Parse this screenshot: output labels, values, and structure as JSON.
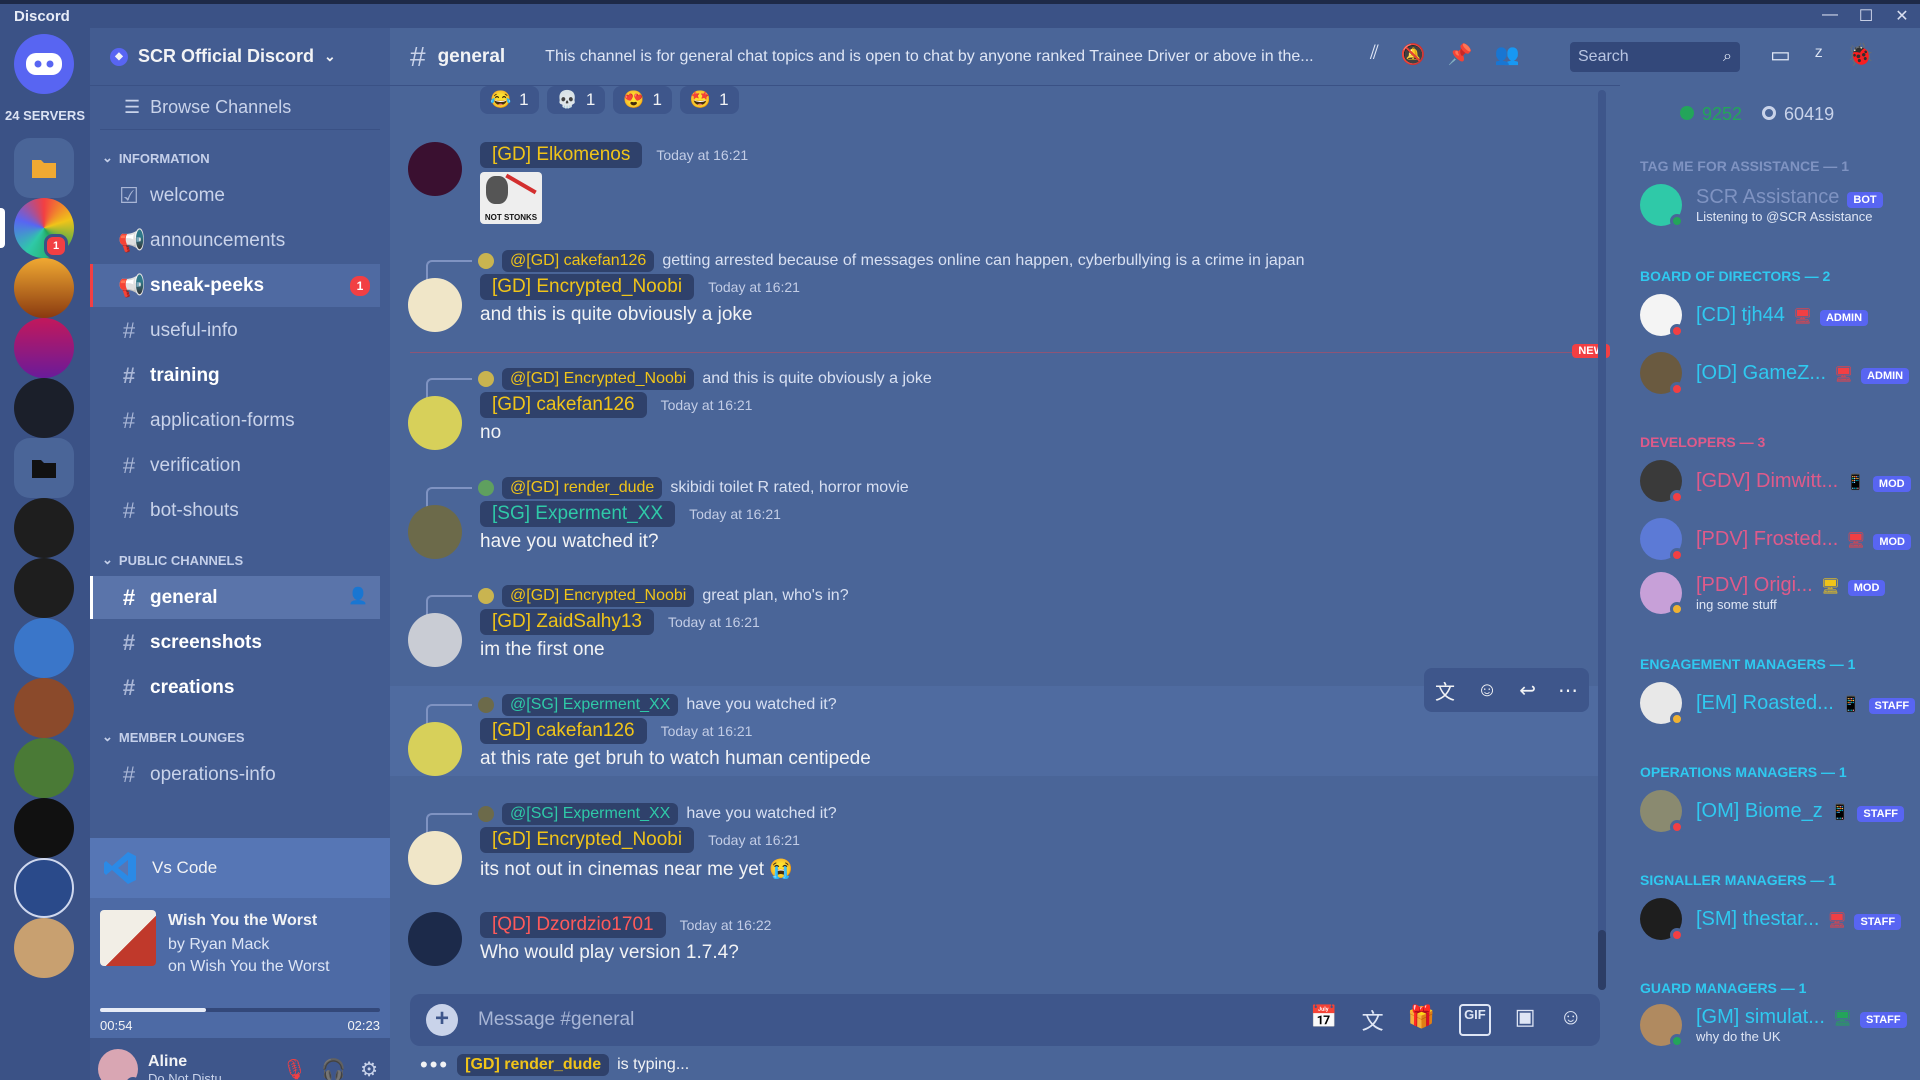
{
  "app": {
    "title": "Discord",
    "min": "—",
    "max": "☐",
    "close": "✕"
  },
  "rail": {
    "servers_count": "24 SERVERS",
    "badge": "1"
  },
  "guild": {
    "name": "SCR Official Discord",
    "browse": "Browse Channels",
    "categories": {
      "information": "INFORMATION",
      "public": "PUBLIC CHANNELS",
      "lounges": "MEMBER LOUNGES"
    },
    "channels": {
      "welcome": "welcome",
      "announcements": "announcements",
      "sneak_peeks": "sneak-peeks",
      "sneak_peeks_count": "1",
      "useful_info": "useful-info",
      "training": "training",
      "application_forms": "application-forms",
      "verification": "verification",
      "bot_shouts": "bot-shouts",
      "general": "general",
      "screenshots": "screenshots",
      "creations": "creations",
      "operations_info": "operations-info"
    }
  },
  "activity": {
    "app": "Vs Code"
  },
  "music": {
    "title": "Wish You the Worst",
    "artist": "by Ryan Mack",
    "album": "on Wish You the Worst",
    "elapsed": "00:54",
    "total": "02:23",
    "progress": 0.38
  },
  "user": {
    "name": "Aline",
    "status": "Do Not Distu..."
  },
  "header": {
    "channel": "general",
    "topic": "This channel is for general chat topics and is open to chat by anyone ranked Trainee Driver or above in the...",
    "search_placeholder": "Search"
  },
  "reactions": [
    {
      "emoji": "😂",
      "count": "1"
    },
    {
      "emoji": "💀",
      "count": "1"
    },
    {
      "emoji": "😍",
      "count": "1"
    },
    {
      "emoji": "🤩",
      "count": "1"
    }
  ],
  "messages": {
    "m1": {
      "author": "[GD] Elkomenos",
      "ts": "Today at 16:21",
      "image_caption": "NOT STONKS"
    },
    "m2": {
      "reply_to": "@[GD] cakefan126",
      "reply_text": "getting arrested because of messages online can happen, cyberbullying is a crime in japan",
      "author": "[GD] Encrypted_Noobi",
      "ts": "Today at 16:21",
      "text": "and this is quite obviously a joke"
    },
    "new_label": "NEW",
    "m3": {
      "reply_to": "@[GD] Encrypted_Noobi",
      "reply_text": "and this is quite obviously a joke",
      "author": "[GD] cakefan126",
      "ts": "Today at 16:21",
      "text": "no"
    },
    "m4": {
      "reply_to": "@[GD] render_dude",
      "reply_text": "skibidi toilet R rated, horror movie",
      "author": "[SG] Experment_XX",
      "ts": "Today at 16:21",
      "text": "have you watched it?"
    },
    "m5": {
      "reply_to": "@[GD] Encrypted_Noobi",
      "reply_text": "great plan, who's in?",
      "author": "[GD] ZaidSalhy13",
      "ts": "Today at 16:21",
      "text": "im the first one"
    },
    "m6": {
      "reply_to": "@[SG] Experment_XX",
      "reply_text": "have you watched it?",
      "author": "[GD] cakefan126",
      "ts": "Today at 16:21",
      "text": "at this rate get bruh to watch human centipede"
    },
    "m7": {
      "reply_to": "@[SG] Experment_XX",
      "reply_text": "have you watched it?",
      "author": "[GD] Encrypted_Noobi",
      "ts": "Today at 16:21",
      "text": "its not out in cinemas near me yet 😭"
    },
    "m8": {
      "author": "[QD] Dzordzio1701",
      "ts": "Today at 16:22",
      "text": "Who would play version 1.7.4?"
    }
  },
  "composer": {
    "placeholder": "Message #general",
    "gif": "GIF"
  },
  "typing": {
    "user": "[GD] render_dude",
    "text": "is typing..."
  },
  "members": {
    "online": "9252",
    "offline": "60419",
    "roles": {
      "assist": "TAG ME FOR ASSISTANCE — 1",
      "board": "BOARD OF DIRECTORS — 2",
      "devs": "DEVELOPERS — 3",
      "em": "ENGAGEMENT MANAGERS — 1",
      "om": "OPERATIONS MANAGERS — 1",
      "sm": "SIGNALLER MANAGERS — 1",
      "gm": "GUARD MANAGERS — 1"
    },
    "list": {
      "assist": {
        "name": "SCR Assistance",
        "tag": "BOT",
        "sub": "Listening to @SCR Assistance"
      },
      "cd": {
        "name": "[CD] tjh44",
        "tag": "ADMIN"
      },
      "od": {
        "name": "[OD] GameZ...",
        "tag": "ADMIN"
      },
      "gdv": {
        "name": "[GDV] Dimwitt...",
        "tag": "MOD"
      },
      "pdv1": {
        "name": "[PDV] Frosted...",
        "tag": "MOD"
      },
      "pdv2": {
        "name": "[PDV] Origi...",
        "tag": "MOD",
        "sub": "ing some stuff"
      },
      "em": {
        "name": "[EM] Roasted...",
        "tag": "STAFF"
      },
      "om": {
        "name": "[OM] Biome_z",
        "tag": "STAFF"
      },
      "sm": {
        "name": "[SM] thestar...",
        "tag": "STAFF"
      },
      "gm": {
        "name": "[GM] simulat...",
        "tag": "STAFF",
        "sub": "why do the UK"
      }
    }
  }
}
